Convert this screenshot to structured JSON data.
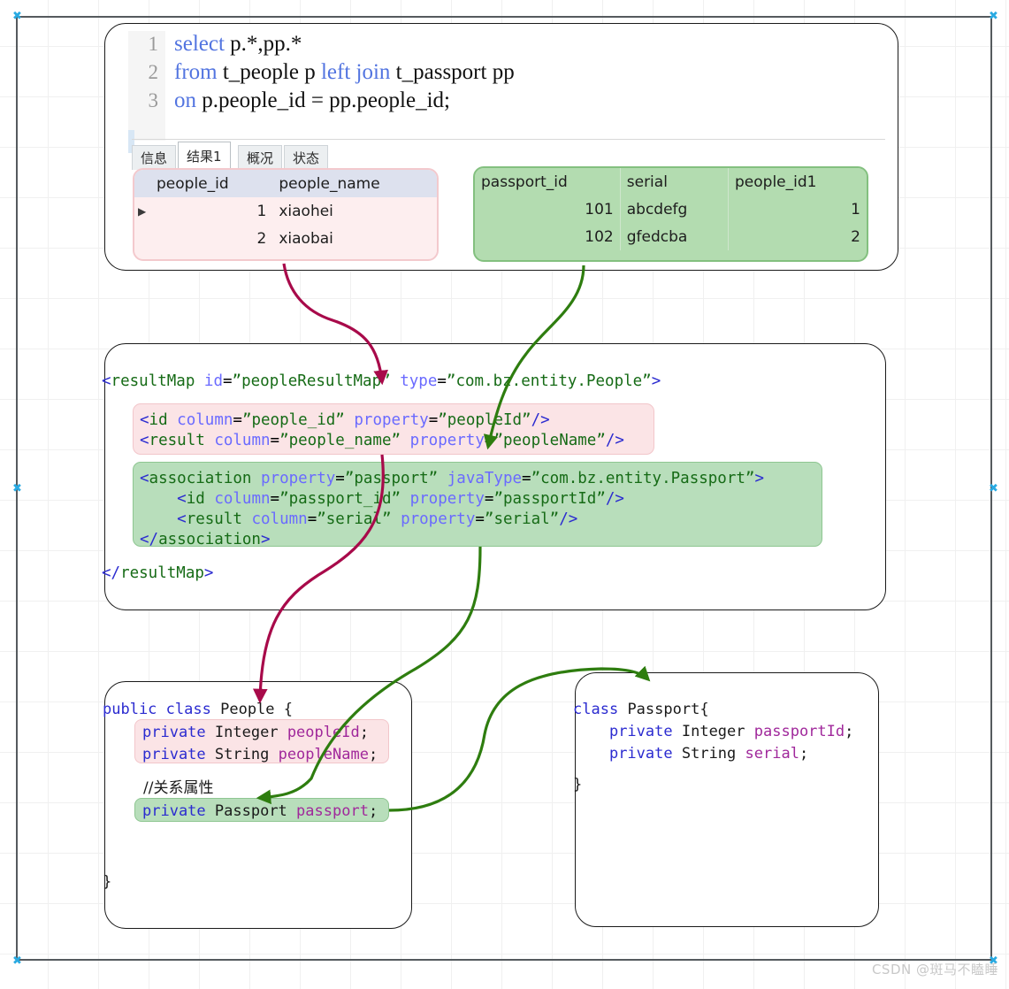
{
  "sql_panel": {
    "lines": [
      {
        "no": "1",
        "parts": [
          {
            "t": "select",
            "k": true
          },
          {
            "t": " p.*,pp.*",
            "k": false
          }
        ]
      },
      {
        "no": "2",
        "parts": [
          {
            "t": "from",
            "k": true
          },
          {
            "t": " t_people p ",
            "k": false
          },
          {
            "t": "left join",
            "k": true
          },
          {
            "t": " t_passport pp",
            "k": false
          }
        ]
      },
      {
        "no": "3",
        "parts": [
          {
            "t": "on",
            "k": true
          },
          {
            "t": " p.people_id = pp.people_id;",
            "k": false
          }
        ]
      }
    ],
    "sql_text": "select p.*,pp.*\nfrom t_people p left join t_passport pp\non p.people_id = pp.people_id;",
    "tabs": [
      {
        "label": "信息",
        "active": false
      },
      {
        "label": "结果1",
        "active": true
      },
      {
        "label": "概况",
        "active": false
      },
      {
        "label": "状态",
        "active": false
      }
    ]
  },
  "result_people": {
    "title": "t_people result grid",
    "columns": [
      "people_id",
      "people_name"
    ],
    "rows": [
      {
        "marker": "▶",
        "people_id": "1",
        "people_name": "xiaohei"
      },
      {
        "marker": "",
        "people_id": "2",
        "people_name": "xiaobai"
      }
    ]
  },
  "result_passport": {
    "title": "t_passport result grid",
    "columns": [
      "passport_id",
      "serial",
      "people_id1"
    ],
    "rows": [
      {
        "passport_id": "101",
        "serial": "abcdefg",
        "people_id1": "1"
      },
      {
        "passport_id": "102",
        "serial": "gfedcba",
        "people_id1": "2"
      }
    ]
  },
  "xml": {
    "open_tag": "<resultMap id=\"peopleResultMap\" type=\"com.bz.entity.People\">",
    "close_tag": "</resultMap>",
    "pink_block": "<id column=\"people_id\" property=\"peopleId\"/>\n<result column=\"people_name\" property=\"peopleName\"/>",
    "green_block": "<association property=\"passport\" javaType=\"com.bz.entity.Passport\">\n    <id column=\"passport_id\" property=\"passportId\"/>\n    <result column=\"serial\" property=\"serial\"/>\n</association>",
    "pink_lines": [
      "<id column=\"people_id\" property=\"peopleId\"/>",
      "<result column=\"people_name\" property=\"peopleName\"/>"
    ],
    "green_lines": [
      "<association property=\"passport\" javaType=\"com.bz.entity.Passport\">",
      "    <id column=\"passport_id\" property=\"passportId\"/>",
      "    <result column=\"serial\" property=\"serial\"/>",
      "</association>"
    ]
  },
  "people_class": {
    "header": "public class People {",
    "fields_block": "private Integer peopleId;\nprivate String peopleName;",
    "fields": [
      "private Integer peopleId;",
      "private String peopleName;"
    ],
    "comment": "//关系属性",
    "relation_field": "private Passport passport;",
    "closing_brace": "}"
  },
  "passport_class": {
    "header": "class Passport{",
    "fields_block": "private Integer passportId;\nprivate String serial;",
    "fields": [
      "private Integer passportId;",
      "private String serial;"
    ],
    "closing_brace": "}"
  },
  "colors": {
    "crimson_arrow": "#A80A4A",
    "green_arrow": "#2E7D0F",
    "pink_fill": "#FBE4E6",
    "green_fill": "#B8DEBB",
    "sql_keyword": "#5274E0",
    "xml_tag": "#166B16",
    "xml_attr": "#6A6AFF",
    "java_keyword": "#2B2BD0",
    "java_field": "#A0289B",
    "frame_border": "#555A5E",
    "handle": "#29AAE2"
  },
  "watermark": "CSDN @斑马不瞌睡",
  "handles": [
    "✖",
    "✖",
    "✖",
    "✖",
    "✖",
    "✖"
  ]
}
